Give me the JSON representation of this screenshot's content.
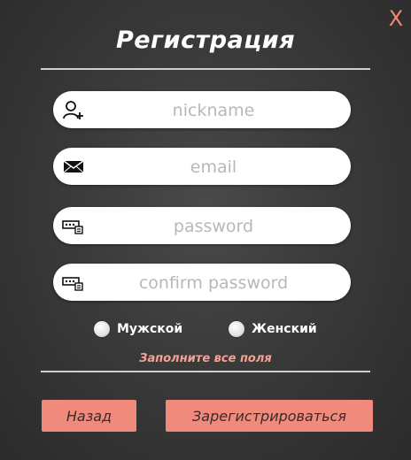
{
  "window": {
    "close_label": "X"
  },
  "header": {
    "title": "Регистрация"
  },
  "form": {
    "nickname": {
      "placeholder": "nickname",
      "value": "",
      "icon": "add-user-icon"
    },
    "email": {
      "placeholder": "email",
      "value": "",
      "icon": "envelope-icon"
    },
    "password": {
      "placeholder": "password",
      "value": "",
      "icon": "password-key-icon"
    },
    "confirm_password": {
      "placeholder": "confirm password",
      "value": "",
      "icon": "password-key-icon"
    },
    "gender": {
      "options": [
        {
          "label": "Мужской",
          "selected": false
        },
        {
          "label": "Женский",
          "selected": false
        }
      ]
    },
    "error_message": "Заполните все поля"
  },
  "buttons": {
    "back_label": "Назад",
    "register_label": "Зарегистрироваться"
  },
  "colors": {
    "accent": "#ef8a7d",
    "close": "#f08878",
    "error_text": "#f2a394",
    "background": "#3a3a3a"
  }
}
